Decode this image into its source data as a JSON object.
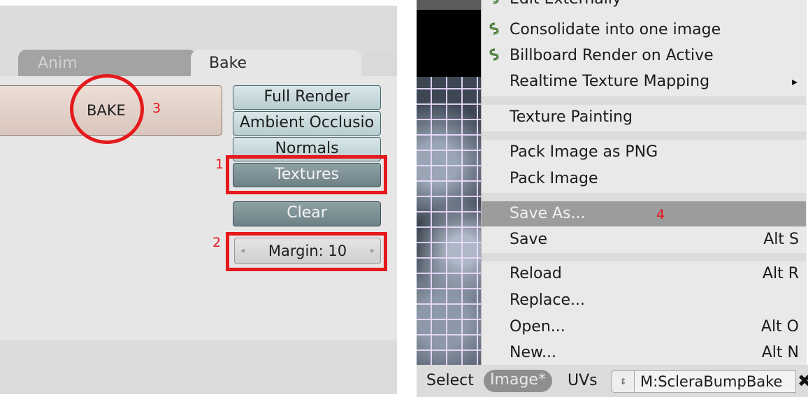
{
  "left_panel": {
    "tabs": [
      {
        "label": "Anim"
      },
      {
        "label": "Bake"
      }
    ],
    "bake_button": "BAKE",
    "bake_modes": [
      "Full Render",
      "Ambient Occlusio",
      "Normals",
      "Textures"
    ],
    "clear_button": "Clear",
    "margin_field": "Margin: 10",
    "annotations": {
      "n1": "1",
      "n2": "2",
      "n3": "3"
    },
    "accent_color": "#e5191c",
    "selected_mode_color": "#7a8f94"
  },
  "image_menu": {
    "items": [
      {
        "label": "Edit Externally",
        "icon": "python-script-icon"
      },
      {
        "label": "Consolidate into one image",
        "icon": "python-script-icon"
      },
      {
        "label": "Billboard Render on Active",
        "icon": "python-script-icon"
      },
      {
        "label": "Realtime Texture Mapping",
        "submenu_arrow": "▸"
      },
      {
        "label": "Texture Painting"
      },
      {
        "label": "Pack Image as PNG"
      },
      {
        "label": "Pack Image"
      },
      {
        "label": "Save As...",
        "highlighted": true
      },
      {
        "label": "Save",
        "shortcut": "Alt S"
      },
      {
        "label": "Reload",
        "shortcut": "Alt R"
      },
      {
        "label": "Replace..."
      },
      {
        "label": "Open...",
        "shortcut": "Alt O"
      },
      {
        "label": "New...",
        "shortcut": "Alt N"
      }
    ],
    "annotation_4": "4",
    "highlight_color": "#9c9c9c"
  },
  "footer": {
    "select": "Select",
    "image": "Image*",
    "uvs": "UVs",
    "image_name": "M:ScleraBumpBake",
    "close_glyph": "✖"
  }
}
